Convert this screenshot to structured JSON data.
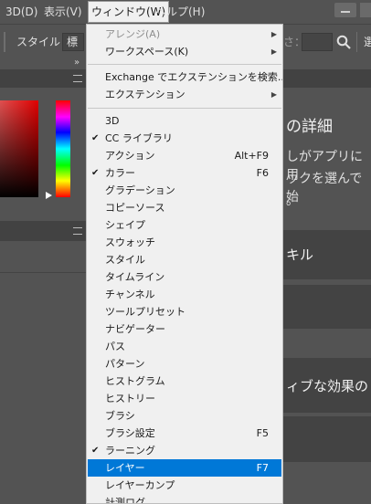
{
  "menubar": {
    "items": [
      "3D(D)",
      "表示(V)",
      "ウィンドウ(W)",
      "ヘルプ(H)"
    ]
  },
  "options": {
    "style_label": "スタイル：",
    "style_value": "標",
    "size_label": "さ：",
    "right_fragment": "選"
  },
  "panels": {
    "collapse_label": "»",
    "heading": "の詳細",
    "line1": "しがアプリに用",
    "line2": "ックを選んで始",
    "line3": "。",
    "skill": "キル",
    "effect": "ィブな効果の"
  },
  "menu": {
    "items": [
      {
        "label": "アレンジ(A)",
        "disabled": true,
        "submenu": true
      },
      {
        "label": "ワークスペース(K)",
        "submenu": true
      },
      {
        "label": "Exchange でエクステンションを検索..."
      },
      {
        "label": "エクステンション",
        "submenu": true
      },
      {
        "label": "3D"
      },
      {
        "label": "CC ライブラリ",
        "checked": true
      },
      {
        "label": "アクション",
        "shortcut": "Alt+F9"
      },
      {
        "label": "カラー",
        "checked": true,
        "shortcut": "F6"
      },
      {
        "label": "グラデーション"
      },
      {
        "label": "コピーソース"
      },
      {
        "label": "シェイプ"
      },
      {
        "label": "スウォッチ"
      },
      {
        "label": "スタイル"
      },
      {
        "label": "タイムライン"
      },
      {
        "label": "チャンネル"
      },
      {
        "label": "ツールプリセット"
      },
      {
        "label": "ナビゲーター"
      },
      {
        "label": "パス"
      },
      {
        "label": "パターン"
      },
      {
        "label": "ヒストグラム"
      },
      {
        "label": "ヒストリー"
      },
      {
        "label": "ブラシ"
      },
      {
        "label": "ブラシ設定",
        "shortcut": "F5"
      },
      {
        "label": "ラーニング",
        "checked": true
      },
      {
        "label": "レイヤー",
        "shortcut": "F7",
        "highlighted": true
      },
      {
        "label": "レイヤーカンプ"
      },
      {
        "label": "計測ログ"
      }
    ]
  }
}
